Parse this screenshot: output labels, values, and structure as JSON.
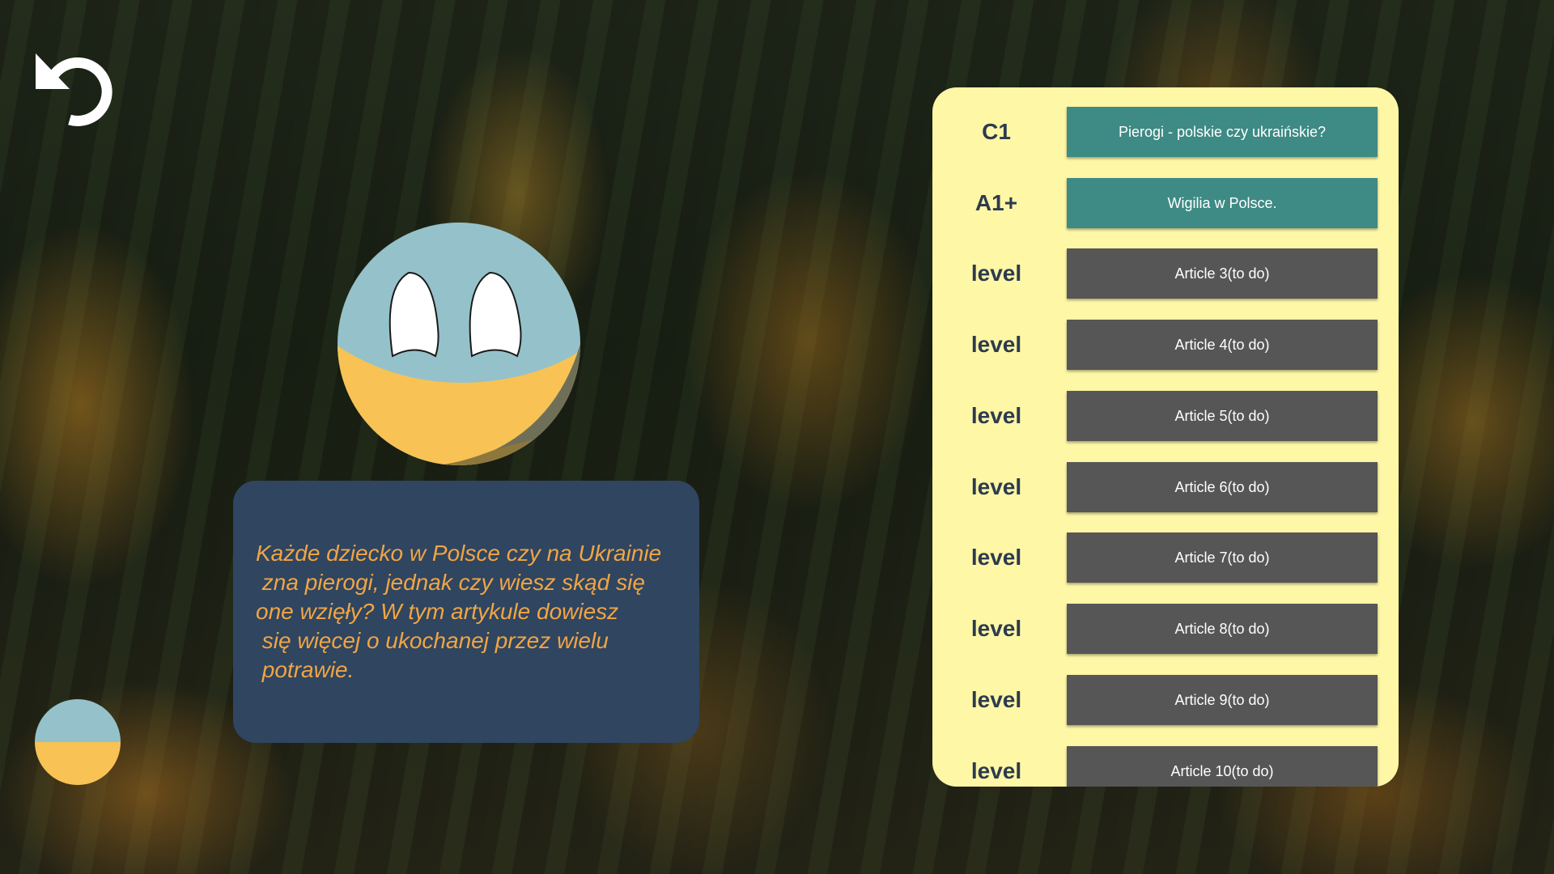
{
  "colors": {
    "panel_bg": "#fdf7a6",
    "active_button": "#3e8a85",
    "todo_button": "#565656",
    "speech_bg": "#2f4560",
    "speech_text": "#f0a544",
    "ball_blue": "#95c2ca",
    "ball_yellow": "#f8c254"
  },
  "icons": {
    "back": "undo-arrow-icon",
    "mascot": "ukraine-ball-mascot",
    "flag": "ukraine-flag-ball-icon"
  },
  "speech": {
    "text": "Każde dziecko w Polsce czy na Ukrainie\n zna pierogi, jednak czy wiesz skąd się\none wzięły? W tym artykule dowiesz\n się więcej o ukochanej przez wielu\n potrawie."
  },
  "articles": [
    {
      "level": "C1",
      "title": "Pierogi - polskie czy ukraińskie?",
      "state": "active"
    },
    {
      "level": "A1+",
      "title": "Wigilia w Polsce.",
      "state": "active"
    },
    {
      "level": "level",
      "title": "Article 3(to do)",
      "state": "todo"
    },
    {
      "level": "level",
      "title": "Article 4(to do)",
      "state": "todo"
    },
    {
      "level": "level",
      "title": "Article 5(to do)",
      "state": "todo"
    },
    {
      "level": "level",
      "title": "Article 6(to do)",
      "state": "todo"
    },
    {
      "level": "level",
      "title": "Article 7(to do)",
      "state": "todo"
    },
    {
      "level": "level",
      "title": "Article 8(to do)",
      "state": "todo"
    },
    {
      "level": "level",
      "title": "Article 9(to do)",
      "state": "todo"
    },
    {
      "level": "level",
      "title": "Article 10(to do)",
      "state": "todo"
    }
  ]
}
